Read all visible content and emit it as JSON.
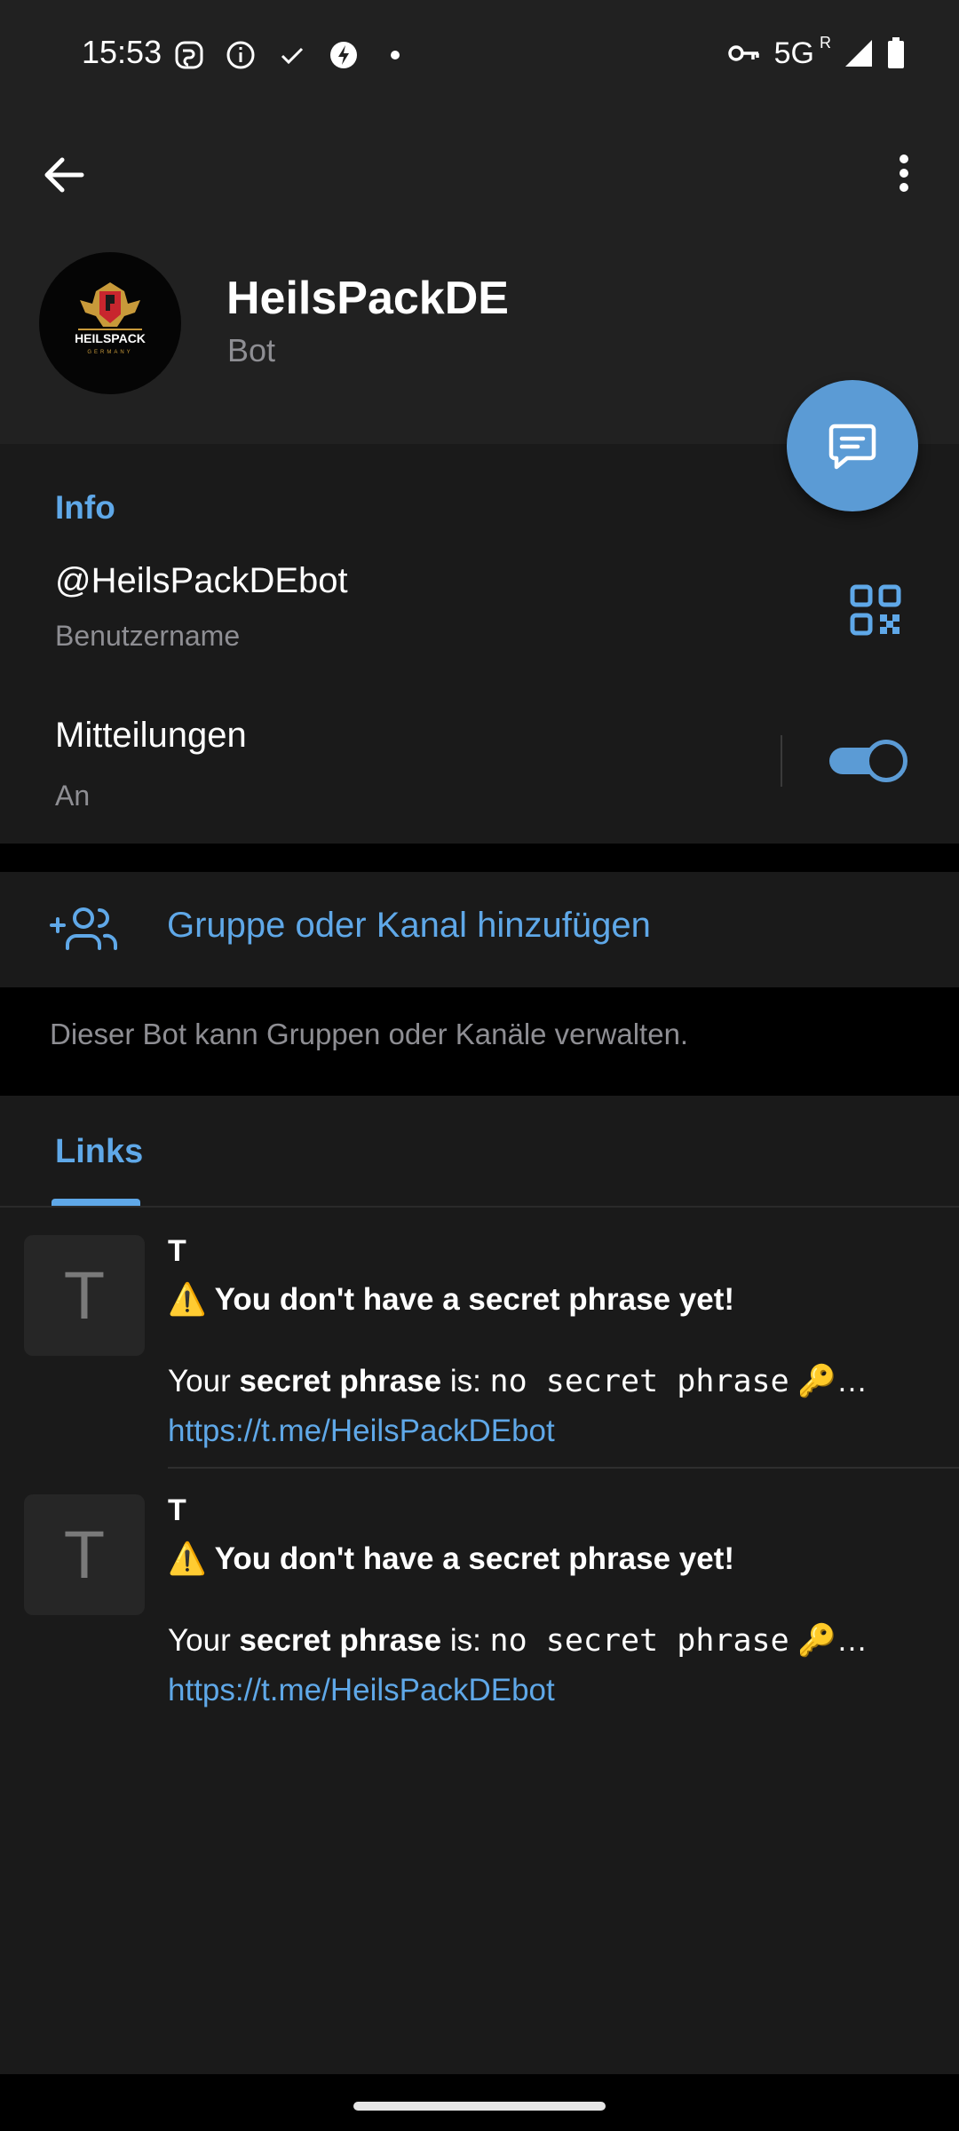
{
  "status_bar": {
    "time": "15:53",
    "network": "5G",
    "roaming": "R"
  },
  "header": {
    "name": "HeilsPackDE",
    "subtitle": "Bot",
    "avatar_text": "HEILSPACK",
    "avatar_subtext": "GERMANY"
  },
  "info": {
    "title": "Info",
    "username": "@HeilsPackDEbot",
    "username_caption": "Benutzername",
    "notifications_label": "Mitteilungen",
    "notifications_value": "An"
  },
  "actions": {
    "add_group_label": "Gruppe oder Kanal hinzufügen",
    "bot_info": "Dieser Bot kann Gruppen oder Kanäle verwalten."
  },
  "tabs": {
    "links": "Links"
  },
  "links": [
    {
      "thumb_letter": "T",
      "title": "T",
      "heading": "⚠️ You don't have a secret phrase yet!",
      "desc_prefix": "Your ",
      "desc_bold": "secret phrase",
      "desc_mid": " is: ",
      "desc_mono": "no secret phrase",
      "desc_suffix": " 🔑…",
      "url": "https://t.me/HeilsPackDEbot"
    },
    {
      "thumb_letter": "T",
      "title": "T",
      "heading": "⚠️ You don't have a secret phrase yet!",
      "desc_prefix": "Your ",
      "desc_bold": "secret phrase",
      "desc_mid": " is: ",
      "desc_mono": "no secret phrase",
      "desc_suffix": " 🔑…",
      "url": "https://t.me/HeilsPackDEbot"
    }
  ],
  "colors": {
    "accent": "#5fa8e8",
    "fab": "#5b9bd5",
    "header_bg": "#212121",
    "section_bg": "#1a1a1a"
  }
}
